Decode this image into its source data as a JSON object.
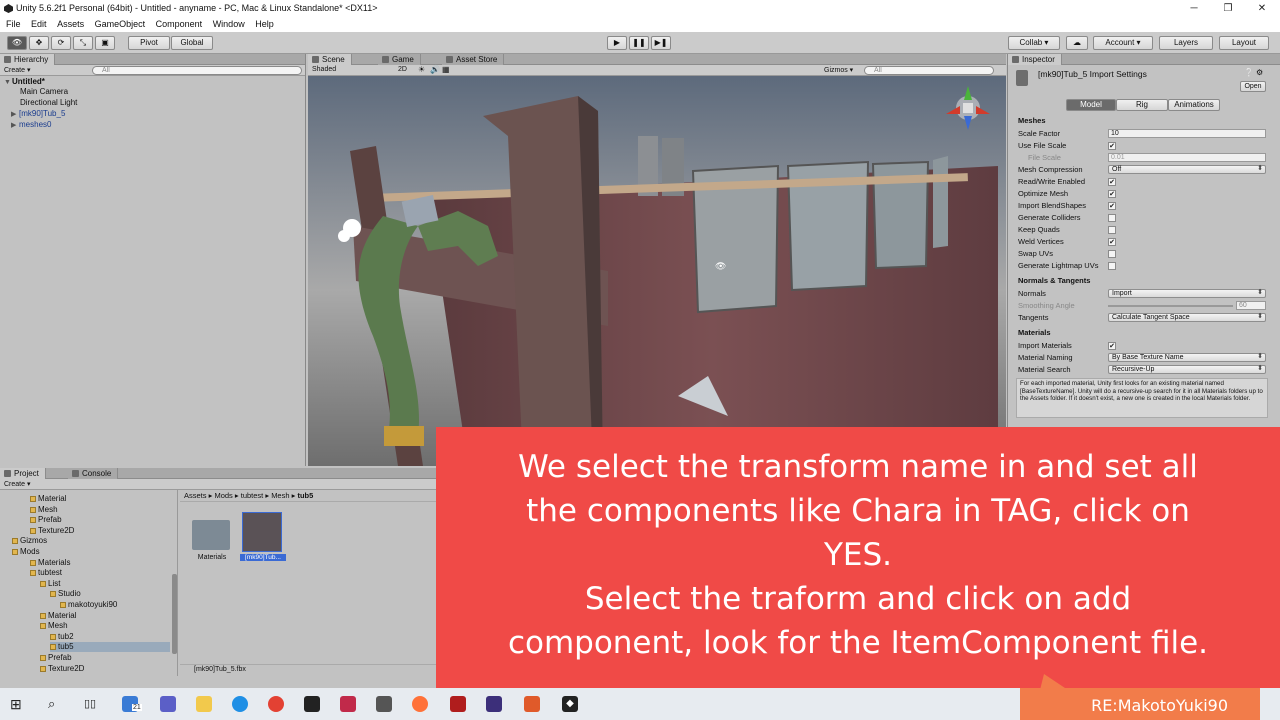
{
  "window": {
    "title": "Unity 5.6.2f1 Personal (64bit) - Untitled - anyname - PC, Mac & Linux Standalone* <DX11>",
    "min": "─",
    "max": "❐",
    "close": "✕"
  },
  "menu": [
    "File",
    "Edit",
    "Assets",
    "GameObject",
    "Component",
    "Window",
    "Help"
  ],
  "toolbar": {
    "pivot": "Pivot",
    "global": "Global",
    "collab": "Collab ▾",
    "account": "Account ▾",
    "layers": "Layers",
    "layout": "Layout"
  },
  "hierarchy": {
    "tab": "Hierarchy",
    "create": "Create ▾",
    "search_placeholder": "All",
    "scene": "Untitled*",
    "items": [
      {
        "label": "Main Camera",
        "blue": false,
        "arrow": ""
      },
      {
        "label": "Directional Light",
        "blue": false,
        "arrow": ""
      },
      {
        "label": "[mk90]Tub_5",
        "blue": true,
        "arrow": "▶"
      },
      {
        "label": "meshes0",
        "blue": true,
        "arrow": "▶"
      }
    ]
  },
  "scene_view": {
    "tabs": [
      "Scene",
      "Game",
      "Asset Store"
    ],
    "shading": "Shaded",
    "mode": "2D",
    "gizmos": "Gizmos ▾",
    "search_placeholder": "All"
  },
  "inspector": {
    "tab": "Inspector",
    "title": "[mk90]Tub_5 Import Settings",
    "open": "Open",
    "tabs": [
      "Model",
      "Rig",
      "Animations"
    ],
    "active_tab": "Model",
    "meshes_header": "Meshes",
    "rows": [
      {
        "label": "Scale Factor",
        "kind": "field",
        "value": "10"
      },
      {
        "label": "Use File Scale",
        "kind": "check",
        "value": "✔"
      },
      {
        "label": "File Scale",
        "kind": "field",
        "value": "0.01",
        "dim": true
      },
      {
        "label": "Mesh Compression",
        "kind": "drop",
        "value": "Off"
      },
      {
        "label": "Read/Write Enabled",
        "kind": "check",
        "value": "✔"
      },
      {
        "label": "Optimize Mesh",
        "kind": "check",
        "value": "✔"
      },
      {
        "label": "Import BlendShapes",
        "kind": "check",
        "value": "✔"
      },
      {
        "label": "Generate Colliders",
        "kind": "check",
        "value": ""
      },
      {
        "label": "Keep Quads",
        "kind": "check",
        "value": ""
      },
      {
        "label": "Weld Vertices",
        "kind": "check",
        "value": "✔"
      },
      {
        "label": "Swap UVs",
        "kind": "check",
        "value": ""
      },
      {
        "label": "Generate Lightmap UVs",
        "kind": "check",
        "value": ""
      }
    ],
    "normals_header": "Normals & Tangents",
    "normals": "Import",
    "smoothing_label": "Smoothing Angle",
    "smoothing_value": "60",
    "tangents": "Calculate Tangent Space",
    "materials_header": "Materials",
    "import_materials": "✔",
    "material_naming": "By Base Texture Name",
    "material_search": "Recursive-Up",
    "help": "For each imported material, Unity first looks for an existing material named [BaseTextureName]. Unity will do a recursive-up search for it in all Materials folders up to the Assets folder. If it doesn't exist, a new one is created in the local Materials folder.",
    "labels": {
      "normals": "Normals",
      "tangents": "Tangents",
      "import_materials": "Import Materials",
      "material_naming": "Material Naming",
      "material_search": "Material Search"
    }
  },
  "project": {
    "tabs": [
      "Project",
      "Console"
    ],
    "create": "Create ▾",
    "tree": [
      {
        "label": "Material",
        "indent": 30
      },
      {
        "label": "Mesh",
        "indent": 30
      },
      {
        "label": "Prefab",
        "indent": 30
      },
      {
        "label": "Texture2D",
        "indent": 30
      },
      {
        "label": "Gizmos",
        "indent": 12
      },
      {
        "label": "Mods",
        "indent": 12
      },
      {
        "label": "Materials",
        "indent": 30
      },
      {
        "label": "tubtest",
        "indent": 30
      },
      {
        "label": "List",
        "indent": 40
      },
      {
        "label": "Studio",
        "indent": 50
      },
      {
        "label": "makotoyuki90",
        "indent": 60
      },
      {
        "label": "Material",
        "indent": 40
      },
      {
        "label": "Mesh",
        "indent": 40
      },
      {
        "label": "tub2",
        "indent": 50
      },
      {
        "label": "tub5",
        "indent": 50
      },
      {
        "label": "Prefab",
        "indent": 40
      },
      {
        "label": "Texture2D",
        "indent": 40
      }
    ],
    "breadcrumb": [
      "Assets",
      "Mods",
      "tubtest",
      "Mesh",
      "tub5"
    ],
    "assets": [
      {
        "label": "Materials"
      },
      {
        "label": "[mk90]Tub..."
      }
    ],
    "footer_file": "[mk90]Tub_5.fbx"
  },
  "overlay": {
    "lines": [
      "We select the transform name in and set all",
      "the components like Chara in TAG, click on",
      "YES.",
      "Select the traform and click on add",
      "component, look for the ItemComponent file."
    ]
  },
  "taskbar": {
    "search_badge": "21"
  },
  "watermark": "RE:MakotoYuki90",
  "colors": {
    "overlay": "#f04a47",
    "bubble": "#f27c4a"
  }
}
